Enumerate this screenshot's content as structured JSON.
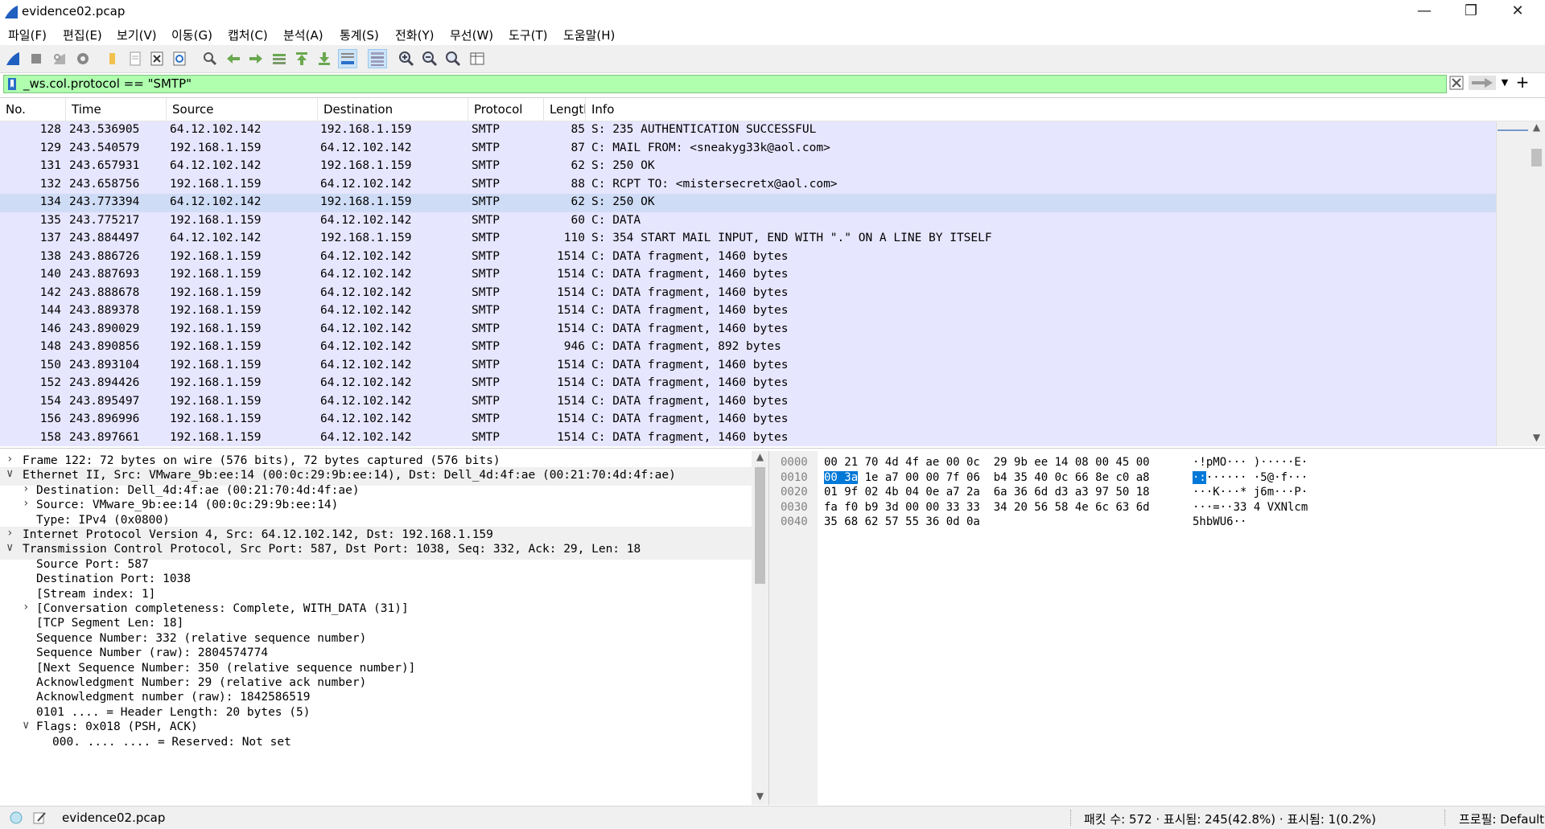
{
  "window": {
    "title": "evidence02.pcap"
  },
  "menu": [
    "파일(F)",
    "편집(E)",
    "보기(V)",
    "이동(G)",
    "캡처(C)",
    "분석(A)",
    "통계(S)",
    "전화(Y)",
    "무선(W)",
    "도구(T)",
    "도움말(H)"
  ],
  "filter": {
    "value": "_ws.col.protocol == \"SMTP\""
  },
  "packet_list": {
    "columns": [
      "No.",
      "Time",
      "Source",
      "Destination",
      "Protocol",
      "Length",
      "Info"
    ],
    "rows": [
      {
        "no": "128",
        "time": "243.536905",
        "src": "64.12.102.142",
        "dst": "192.168.1.159",
        "proto": "SMTP",
        "len": "85",
        "info": "S: 235 AUTHENTICATION SUCCESSFUL"
      },
      {
        "no": "129",
        "time": "243.540579",
        "src": "192.168.1.159",
        "dst": "64.12.102.142",
        "proto": "SMTP",
        "len": "87",
        "info": "C: MAIL FROM: <sneakyg33k@aol.com>"
      },
      {
        "no": "131",
        "time": "243.657931",
        "src": "64.12.102.142",
        "dst": "192.168.1.159",
        "proto": "SMTP",
        "len": "62",
        "info": "S: 250 OK"
      },
      {
        "no": "132",
        "time": "243.658756",
        "src": "192.168.1.159",
        "dst": "64.12.102.142",
        "proto": "SMTP",
        "len": "88",
        "info": "C: RCPT TO: <mistersecretx@aol.com>"
      },
      {
        "no": "134",
        "time": "243.773394",
        "src": "64.12.102.142",
        "dst": "192.168.1.159",
        "proto": "SMTP",
        "len": "62",
        "info": "S: 250 OK",
        "selected": true
      },
      {
        "no": "135",
        "time": "243.775217",
        "src": "192.168.1.159",
        "dst": "64.12.102.142",
        "proto": "SMTP",
        "len": "60",
        "info": "C: DATA"
      },
      {
        "no": "137",
        "time": "243.884497",
        "src": "64.12.102.142",
        "dst": "192.168.1.159",
        "proto": "SMTP",
        "len": "110",
        "info": "S: 354 START MAIL INPUT, END WITH \".\" ON A LINE BY ITSELF"
      },
      {
        "no": "138",
        "time": "243.886726",
        "src": "192.168.1.159",
        "dst": "64.12.102.142",
        "proto": "SMTP",
        "len": "1514",
        "info": "C: DATA fragment, 1460 bytes"
      },
      {
        "no": "140",
        "time": "243.887693",
        "src": "192.168.1.159",
        "dst": "64.12.102.142",
        "proto": "SMTP",
        "len": "1514",
        "info": "C: DATA fragment, 1460 bytes"
      },
      {
        "no": "142",
        "time": "243.888678",
        "src": "192.168.1.159",
        "dst": "64.12.102.142",
        "proto": "SMTP",
        "len": "1514",
        "info": "C: DATA fragment, 1460 bytes"
      },
      {
        "no": "144",
        "time": "243.889378",
        "src": "192.168.1.159",
        "dst": "64.12.102.142",
        "proto": "SMTP",
        "len": "1514",
        "info": "C: DATA fragment, 1460 bytes"
      },
      {
        "no": "146",
        "time": "243.890029",
        "src": "192.168.1.159",
        "dst": "64.12.102.142",
        "proto": "SMTP",
        "len": "1514",
        "info": "C: DATA fragment, 1460 bytes"
      },
      {
        "no": "148",
        "time": "243.890856",
        "src": "192.168.1.159",
        "dst": "64.12.102.142",
        "proto": "SMTP",
        "len": "946",
        "info": "C: DATA fragment, 892 bytes"
      },
      {
        "no": "150",
        "time": "243.893104",
        "src": "192.168.1.159",
        "dst": "64.12.102.142",
        "proto": "SMTP",
        "len": "1514",
        "info": "C: DATA fragment, 1460 bytes"
      },
      {
        "no": "152",
        "time": "243.894426",
        "src": "192.168.1.159",
        "dst": "64.12.102.142",
        "proto": "SMTP",
        "len": "1514",
        "info": "C: DATA fragment, 1460 bytes"
      },
      {
        "no": "154",
        "time": "243.895497",
        "src": "192.168.1.159",
        "dst": "64.12.102.142",
        "proto": "SMTP",
        "len": "1514",
        "info": "C: DATA fragment, 1460 bytes"
      },
      {
        "no": "156",
        "time": "243.896996",
        "src": "192.168.1.159",
        "dst": "64.12.102.142",
        "proto": "SMTP",
        "len": "1514",
        "info": "C: DATA fragment, 1460 bytes"
      },
      {
        "no": "158",
        "time": "243.897661",
        "src": "192.168.1.159",
        "dst": "64.12.102.142",
        "proto": "SMTP",
        "len": "1514",
        "info": "C: DATA fragment, 1460 bytes"
      }
    ]
  },
  "details": [
    {
      "text": "Frame 122: 72 bytes on wire (576 bits), 72 bytes captured (576 bits)",
      "level": 0,
      "exp": "collapsed"
    },
    {
      "text": "Ethernet II, Src: VMware_9b:ee:14 (00:0c:29:9b:ee:14), Dst: Dell_4d:4f:ae (00:21:70:4d:4f:ae)",
      "level": 0,
      "exp": "expanded",
      "shade": true
    },
    {
      "text": "Destination: Dell_4d:4f:ae (00:21:70:4d:4f:ae)",
      "level": 1,
      "exp": "collapsed"
    },
    {
      "text": "Source: VMware_9b:ee:14 (00:0c:29:9b:ee:14)",
      "level": 1,
      "exp": "collapsed"
    },
    {
      "text": "Type: IPv4 (0x0800)",
      "level": 1,
      "exp": "none"
    },
    {
      "text": "Internet Protocol Version 4, Src: 64.12.102.142, Dst: 192.168.1.159",
      "level": 0,
      "exp": "collapsed",
      "shade": true
    },
    {
      "text": "Transmission Control Protocol, Src Port: 587, Dst Port: 1038, Seq: 332, Ack: 29, Len: 18",
      "level": 0,
      "exp": "expanded",
      "shade": true
    },
    {
      "text": "Source Port: 587",
      "level": 1,
      "exp": "none"
    },
    {
      "text": "Destination Port: 1038",
      "level": 1,
      "exp": "none"
    },
    {
      "text": "[Stream index: 1]",
      "level": 1,
      "exp": "none"
    },
    {
      "text": "[Conversation completeness: Complete, WITH_DATA (31)]",
      "level": 1,
      "exp": "collapsed"
    },
    {
      "text": "[TCP Segment Len: 18]",
      "level": 1,
      "exp": "none"
    },
    {
      "text": "Sequence Number: 332    (relative sequence number)",
      "level": 1,
      "exp": "none"
    },
    {
      "text": "Sequence Number (raw): 2804574774",
      "level": 1,
      "exp": "none"
    },
    {
      "text": "[Next Sequence Number: 350    (relative sequence number)]",
      "level": 1,
      "exp": "none"
    },
    {
      "text": "Acknowledgment Number: 29    (relative ack number)",
      "level": 1,
      "exp": "none"
    },
    {
      "text": "Acknowledgment number (raw): 1842586519",
      "level": 1,
      "exp": "none"
    },
    {
      "text": "0101 .... = Header Length: 20 bytes (5)",
      "level": 1,
      "exp": "none"
    },
    {
      "text": "Flags: 0x018 (PSH, ACK)",
      "level": 1,
      "exp": "expanded"
    },
    {
      "text": "000. .... .... = Reserved: Not set",
      "level": 2,
      "exp": "none"
    }
  ],
  "bytes": [
    {
      "off": "0000",
      "hex_a": "00 21 70 4d 4f ae 00 0c",
      "hex_b": "29 9b ee 14 08 00 45 00",
      "ascii": "·!pMO··· )·····E·"
    },
    {
      "off": "0010",
      "hl_hex": "00 3a",
      "hex_a_rest": " 1e a7 00 00 7f 06",
      "hex_b": "b4 35 40 0c 66 8e c0 a8",
      "hl_ascii": "·:",
      "ascii_rest": "······ ·5@·f···"
    },
    {
      "off": "0020",
      "hex_a": "01 9f 02 4b 04 0e a7 2a",
      "hex_b": "6a 36 6d d3 a3 97 50 18",
      "ascii": "···K···* j6m···P·"
    },
    {
      "off": "0030",
      "hex_a": "fa f0 b9 3d 00 00 33 33",
      "hex_b": "34 20 56 58 4e 6c 63 6d",
      "ascii": "···=··33 4 VXNlcm"
    },
    {
      "off": "0040",
      "hex_a": "35 68 62 57 55 36 0d 0a",
      "hex_b": "",
      "ascii": "5hbWU6··"
    }
  ],
  "status": {
    "file": "evidence02.pcap",
    "counts": "패킷 수: 572 · 표시됨: 245(42.8%) · 표시됨: 1(0.2%)",
    "profile": "프로필: Default"
  },
  "colors": {
    "row_bg": "#e7e6ff",
    "row_selected": "#cfdcf5",
    "filter_ok": "#afffaf",
    "byte_highlight": "#0078d7"
  },
  "toolbar_icons": [
    "shark-fin-start-icon",
    "stop-icon",
    "restart-icon",
    "options-gear-icon",
    "open-folder-icon",
    "save-file-icon",
    "close-file-icon",
    "reload-icon",
    "find-icon",
    "back-arrow-icon",
    "forward-arrow-icon",
    "go-to-packet-icon",
    "first-packet-icon",
    "last-packet-icon",
    "autoscroll-icon",
    "colorize-icon",
    "zoom-in-icon",
    "zoom-out-icon",
    "zoom-normal-icon",
    "resize-columns-icon"
  ]
}
